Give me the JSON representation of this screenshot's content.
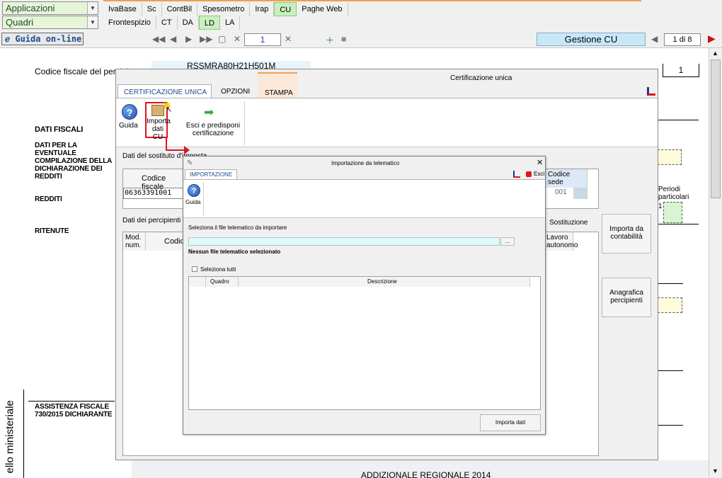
{
  "topbar": {
    "applicazioni": "Applicazioni",
    "quadri": "Quadri",
    "app_tabs": [
      "IvaBase",
      "Sc",
      "ContBil",
      "Spesometro",
      "Irap",
      "CU",
      "Paghe Web"
    ],
    "app_active": "CU",
    "quadri_tabs": [
      "Frontespizio",
      "CT",
      "DA",
      "LD",
      "LA"
    ],
    "quadri_active": "LD"
  },
  "navbar": {
    "guida": "Guida on-line",
    "page": "1",
    "gestione": "Gestione CU",
    "page_of": "1 di 8"
  },
  "form": {
    "codice_fiscale_label": "Codice fiscale del percipiente",
    "codice_fiscale_value": "RSSMRA80H21H501M",
    "mod_value": "1",
    "dati_fiscali": "DATI FISCALI",
    "dati_eventuale": "DATI PER LA EVENTUALE COMPILAZIONE DELLA DICHIARAZIONE DEI REDDITI",
    "redditi": "REDDITI",
    "ritenute": "RITENUTE",
    "periodi": "Periodi particolari",
    "periodi_value": "1",
    "assistenza": "ASSISTENZA FISCALE 730/2015 DICHIARANTE",
    "modello": "ello ministeriale",
    "addizionale": "ADDIZIONALE REGIONALE 2014"
  },
  "cert_window": {
    "title": "Certificazione unica",
    "tabs": [
      "CERTIFICAZIONE UNICA",
      "OPZIONI",
      "STAMPA"
    ],
    "tab_active": "CERTIFICAZIONE UNICA",
    "btn_guida": "Guida",
    "btn_importa": "Importa dati CU",
    "btn_esci": "Esci e predisponi certificazione",
    "sostituto_label": "Dati del sostituto d'imposta",
    "codice_fiscale_header": "Codice fiscale",
    "codice_fiscale_value": "06363391001",
    "codice_sede_header": "Codice sede",
    "codice_sede_value": "001",
    "percipienti_label": "Dati dei percipienti",
    "sostituzione": "Sostituzione",
    "col_mod": "Mod. num.",
    "col_codice": "Codice",
    "col_lavoro": "Lavoro autonomo",
    "btn_importa_contabilita": "Importa da contabilità",
    "btn_anagrafica": "Anagrafica percipienti"
  },
  "import_window": {
    "title": "Importazione da telematico",
    "tab": "IMPORTAZIONE",
    "esci": "Esci",
    "guida": "Guida",
    "select_label": "Seleziona il file telematico da importare",
    "file_value": "",
    "browse": "...",
    "no_file": "Nessun file telematico selezionato",
    "select_all": "Seleziona tutti",
    "col_quadro": "Quadro",
    "col_descrizione": "Descrizione",
    "importa_dati": "Importa dati"
  },
  "colors": {
    "accent_green": "#c9efc0",
    "accent_blue": "#1a4c8c",
    "highlight_red": "#e0141e"
  }
}
